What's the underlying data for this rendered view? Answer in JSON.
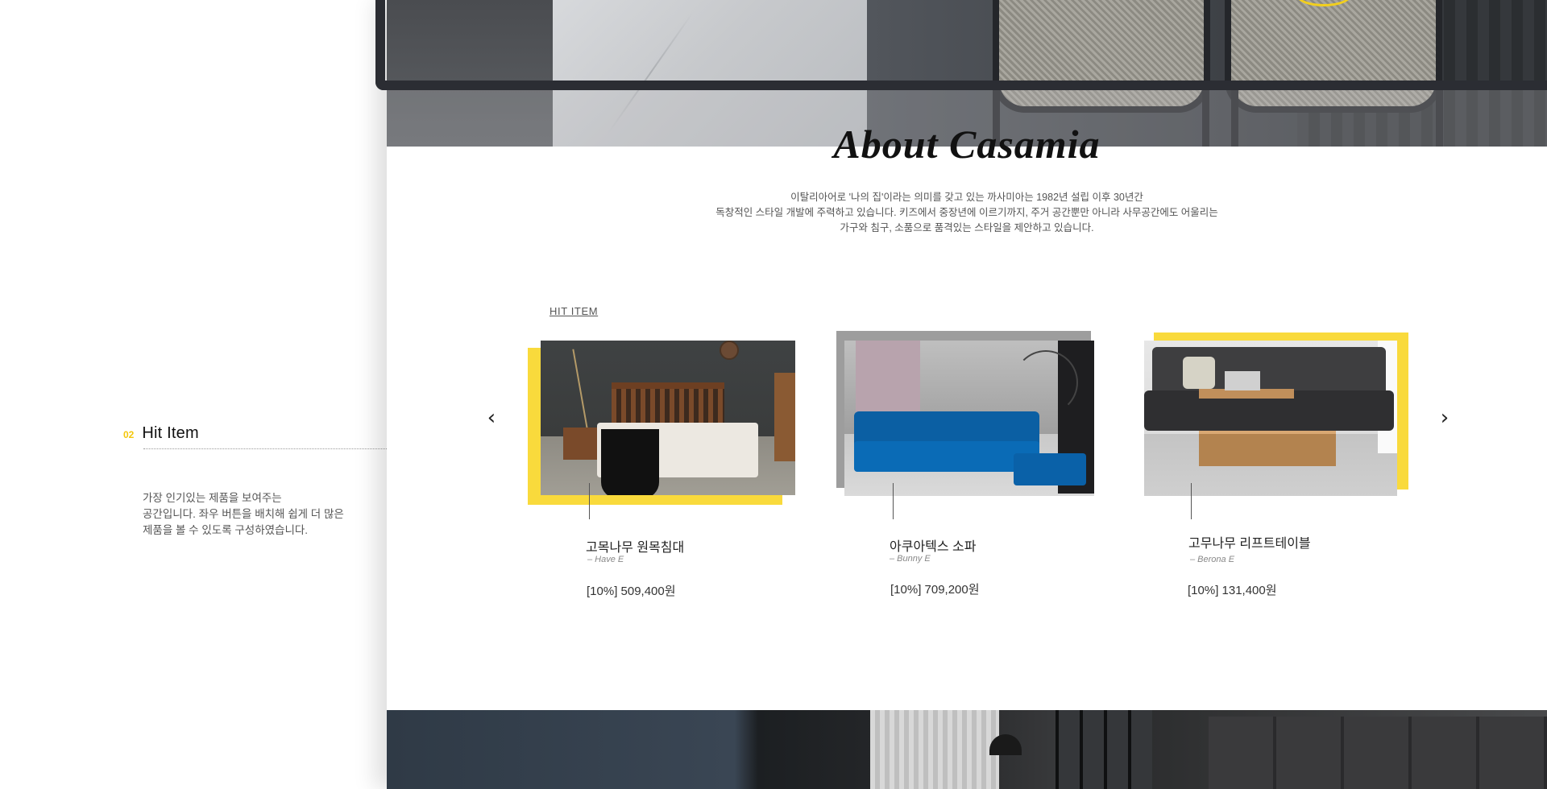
{
  "annotation": {
    "number": "02",
    "title": "Hit Item",
    "description": [
      "가장 인기있는 제품을 보여주는",
      "공간입니다. 좌우 버튼을 배치해 쉽게 더 많은",
      "제품을 볼 수 있도록 구성하였습니다."
    ]
  },
  "about": {
    "title": "About Casamia",
    "text": [
      "이탈리아어로 '나의 집'이라는 의미를 갖고 있는 까사미아는 1982년 설립 이후 30년간",
      "독창적인 스타일 개발에 주력하고 있습니다. 키즈에서 중장년에 이르기까지, 주거 공간뿐만 아니라 사무공간에도 어울리는",
      "가구와 침구, 소품으로 품격있는 스타일을 제안하고 있습니다."
    ]
  },
  "hit_item": {
    "label": "HIT ITEM",
    "prev_icon": "chevron-left-icon",
    "next_icon": "chevron-right-icon",
    "prev_glyph": "‹",
    "next_glyph": "›",
    "products": [
      {
        "name": "고목나무 원목침대",
        "model": "– Have E",
        "price": "[10%] 509,400원",
        "accent": "#f9da3c"
      },
      {
        "name": "아쿠아텍스 소파",
        "model": "– Bunny E",
        "price": "[10%] 709,200원",
        "accent": "#9d9d9d"
      },
      {
        "name": "고무나무 리프트테이블",
        "model": "– Berona E",
        "price": "[10%] 131,400원",
        "accent": "#f9da3c"
      }
    ]
  },
  "colors": {
    "accent_yellow": "#f9da3c",
    "frame_dark": "#2b2d33",
    "number_yellow": "#f4c70b"
  }
}
